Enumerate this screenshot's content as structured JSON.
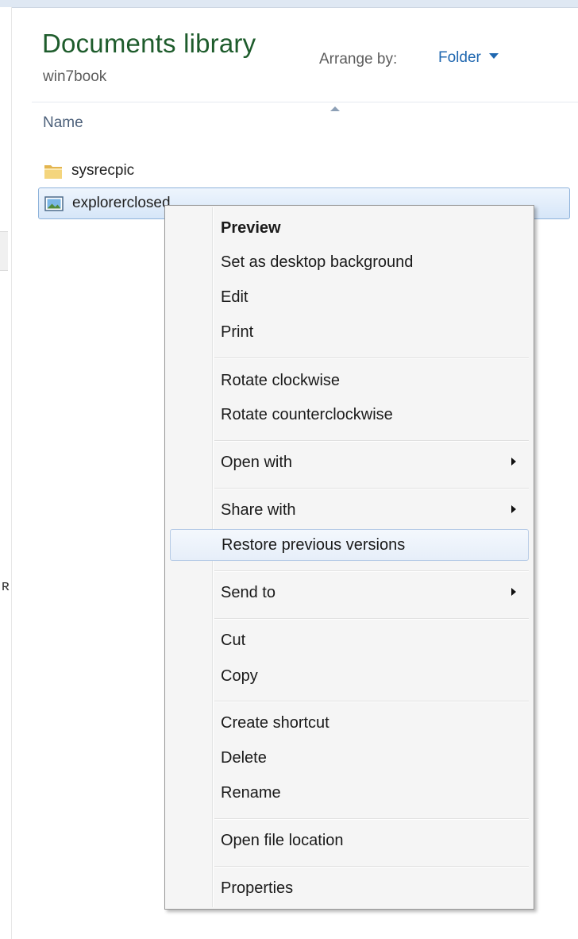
{
  "library": {
    "title": "Documents library",
    "subtitle": "win7book",
    "arrange_label": "Arrange by:",
    "arrange_value": "Folder"
  },
  "columns": {
    "name": "Name"
  },
  "files": [
    {
      "label": "sysrecpic",
      "icon": "folder-icon"
    },
    {
      "label": "explorerclosed",
      "icon": "image-file-icon"
    }
  ],
  "context_menu": {
    "items": [
      {
        "label": "Preview",
        "bold": true
      },
      {
        "label": "Set as desktop background"
      },
      {
        "label": "Edit"
      },
      {
        "label": "Print"
      },
      {
        "label": "Rotate clockwise"
      },
      {
        "label": "Rotate counterclockwise"
      },
      {
        "label": "Open with",
        "submenu": true
      },
      {
        "label": "Share with",
        "submenu": true
      },
      {
        "label": "Restore previous versions",
        "highlighted": true
      },
      {
        "label": "Send to",
        "submenu": true
      },
      {
        "label": "Cut"
      },
      {
        "label": "Copy"
      },
      {
        "label": "Create shortcut"
      },
      {
        "label": "Delete"
      },
      {
        "label": "Rename"
      },
      {
        "label": "Open file location"
      },
      {
        "label": "Properties"
      }
    ]
  },
  "colors": {
    "title_green": "#1e5c2c",
    "link_blue": "#1f67b0",
    "selection_border": "#8fb3db",
    "menu_background": "#f5f5f5"
  }
}
